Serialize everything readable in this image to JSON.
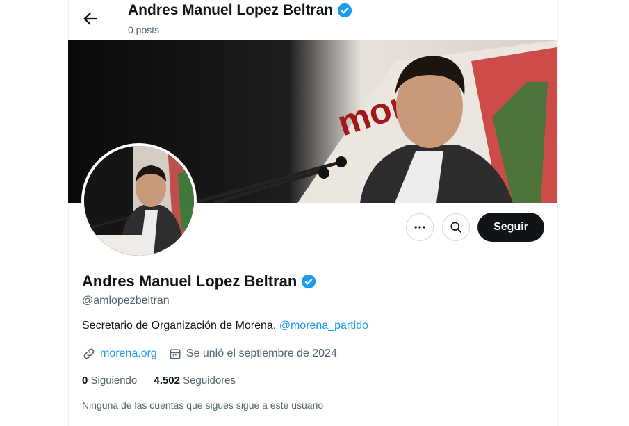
{
  "header": {
    "name": "Andres Manuel Lopez Beltran",
    "posts": "0 posts"
  },
  "profile": {
    "name": "Andres Manuel Lopez Beltran",
    "handle": "@amlopezbeltran",
    "bio_text": "Secretario de Organización de Morena.",
    "bio_mention": "@morena_partido",
    "website": "morena.org",
    "joined": "Se unió el septiembre de 2024",
    "following_count": "0",
    "following_label": "Siguiendo",
    "followers_count": "4.502",
    "followers_label": "Seguidores",
    "followed_by_note": "Ninguna de las cuentas que sigues sigue a este usuario"
  },
  "actions": {
    "follow_label": "Seguir"
  },
  "banner": {
    "sign_text": "more"
  },
  "icons": [
    "back-arrow-icon",
    "verified-badge-icon",
    "more-options-icon",
    "search-icon",
    "link-icon",
    "calendar-icon"
  ],
  "colors": {
    "accent": "#1d9bf0",
    "text": "#0f1419",
    "muted": "#536471",
    "button": "#0f1419"
  }
}
